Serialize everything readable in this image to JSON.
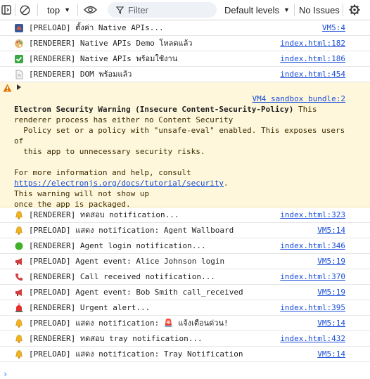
{
  "toolbar": {
    "context": "top",
    "filter_placeholder": "Filter",
    "levels": "Default levels",
    "issues": "No Issues"
  },
  "colors": {
    "link": "#1a4ed8",
    "warning_bg": "#fef7dc",
    "warning_icon": "#e37400"
  },
  "logs_top": [
    {
      "icon": "preload-flag-icon",
      "text": "[PRELOAD] ตั้งค่า Native APIs...",
      "source": "VM5:4"
    },
    {
      "icon": "palette-icon",
      "text": "[RENDERER] Native APIs Demo โหลดแล้ว",
      "source": "index.html:182"
    },
    {
      "icon": "check-mark-icon",
      "text": "[RENDERER] Native APIs พร้อมใช้งาน",
      "source": "index.html:186"
    },
    {
      "icon": "document-icon",
      "text": "[RENDERER] DOM พร้อมแล้ว",
      "source": "index.html:454"
    }
  ],
  "warning": {
    "source": "VM4 sandbox bundle:2",
    "title": "Electron Security Warning (Insecure Content-Security-Policy)",
    "body1": " This\nrenderer process has either no Content Security\n  Policy set or a policy with \"unsafe-eval\" enabled. This exposes users\nof\n  this app to unnecessary security risks.\n\nFor more information and help, consult\n",
    "link": "https://electronjs.org/docs/tutorial/security",
    "body2": ".\nThis warning will not show up\nonce the app is packaged."
  },
  "logs_bottom": [
    {
      "icon": "bell-icon",
      "text": "[RENDERER] ทดสอบ notification...",
      "source": "index.html:323"
    },
    {
      "icon": "bell-icon",
      "text": "[PRELOAD] แสดง notification: Agent Wallboard",
      "source": "VM5:14"
    },
    {
      "icon": "green-circle-icon",
      "text": "[RENDERER] Agent login notification...",
      "source": "index.html:346"
    },
    {
      "icon": "megaphone-icon",
      "text": "[PRELOAD] Agent event: Alice Johnson login",
      "source": "VM5:19"
    },
    {
      "icon": "phone-icon",
      "text": "[RENDERER] Call received notification...",
      "source": "index.html:370"
    },
    {
      "icon": "megaphone-icon",
      "text": "[PRELOAD] Agent event: Bob Smith call_received",
      "source": "VM5:19"
    },
    {
      "icon": "siren-icon",
      "text": "[RENDERER] Urgent alert...",
      "source": "index.html:395"
    },
    {
      "icon": "bell-icon",
      "text": "[PRELOAD] แสดง notification: 🚨 แจ้งเตือนด่วน!",
      "source": "VM5:14"
    },
    {
      "icon": "bell-icon",
      "text": "[RENDERER] ทดสอบ tray notification...",
      "source": "index.html:432"
    },
    {
      "icon": "bell-icon",
      "text": "[PRELOAD] แสดง notification: Tray Notification",
      "source": "VM5:14"
    }
  ],
  "prompt_symbol": "›"
}
